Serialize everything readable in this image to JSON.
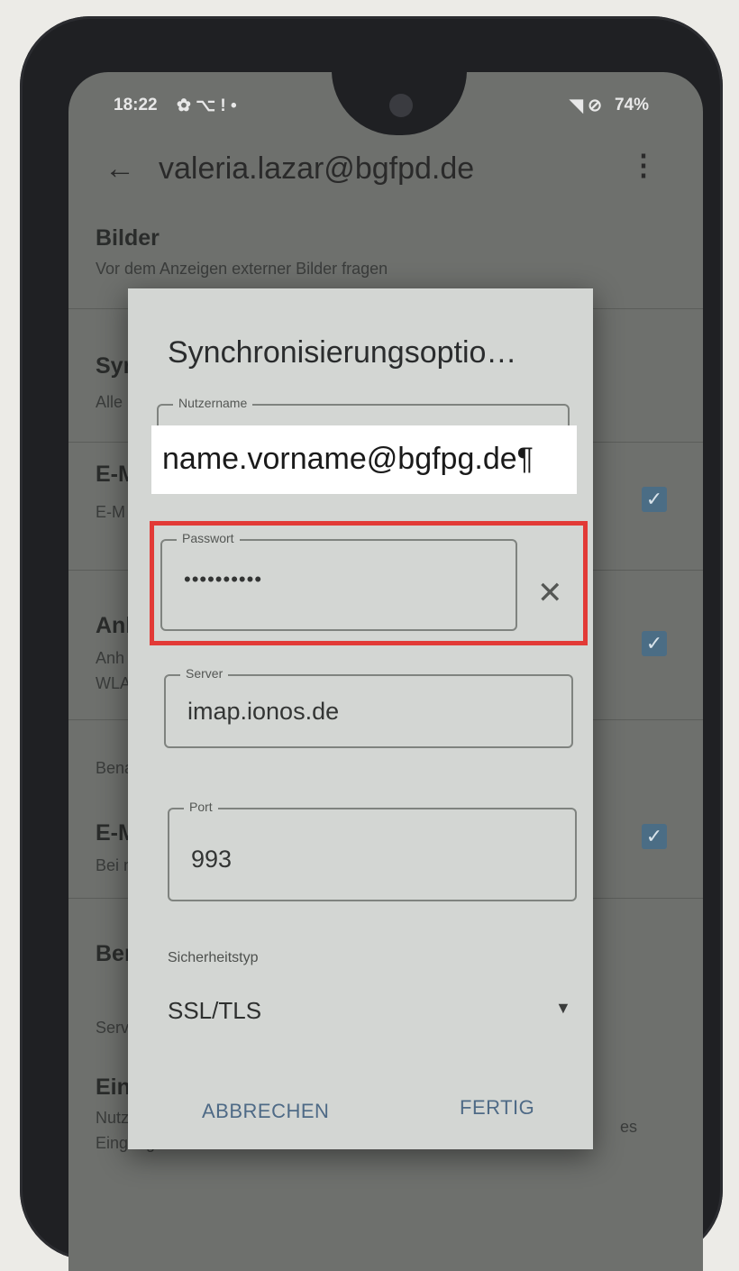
{
  "status_bar": {
    "time": "18:22",
    "left_icons": "✿ ⌥ ! •",
    "battery": "74%",
    "right_icons": "◥ ⊘"
  },
  "app_bar": {
    "account": "valeria.lazar@bgfpd.de"
  },
  "background_settings": {
    "bilder_title": "Bilder",
    "bilder_sub": "Vor dem Anzeigen externer Bilder fragen",
    "sync_title": "Syn",
    "sync_sub": "Alle",
    "email_title": "E-M",
    "email_sub": "E-M",
    "anh_title": "Anh",
    "anh_sub1": "Anh",
    "anh_sub2": "WLA",
    "bena_label": "Bena",
    "email2_title": "E-M",
    "email2_sub": "Bei n",
    "ben_title": "Ben",
    "serv_label": "Serv",
    "eins_title": "Eins",
    "eins_sub1": "Nutz",
    "eins_sub2": "Eingangsservers",
    "es_fragment": "es"
  },
  "dialog": {
    "title": "Synchronisierungsoptio…",
    "username_label": "Nutzername",
    "password_label": "Passwort",
    "password_value": "••••••••••",
    "server_label": "Server",
    "server_value": "imap.ionos.de",
    "port_label": "Port",
    "port_value": "993",
    "security_label": "Sicherheitstyp",
    "security_value": "SSL/TLS",
    "cancel_label": "ABBRECHEN",
    "done_label": "FERTIG"
  },
  "overlay": {
    "username_cover_text": "name.vorname@bgfpg.de¶"
  },
  "colors": {
    "highlight": "#e23a36",
    "accent": "#4e6a86",
    "dialog_bg": "#d3d6d3"
  }
}
